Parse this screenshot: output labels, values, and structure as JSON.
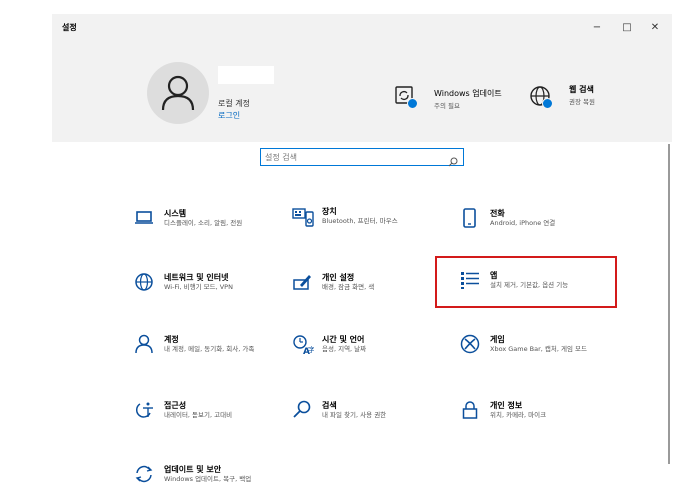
{
  "window": {
    "title": "설정",
    "minimize": "−",
    "maximize": "□",
    "close": "✕"
  },
  "header": {
    "account": {
      "label": "로컬 계정",
      "signin_link": "로그인"
    },
    "windows_update": {
      "title": "Windows 업데이트",
      "subtitle": "주의 필요",
      "icon": "windows-update-icon"
    },
    "web_search": {
      "title": "웹 검색",
      "subtitle": "권장 복원",
      "icon": "globe-icon"
    }
  },
  "search": {
    "placeholder": "설정 검색"
  },
  "tiles": [
    {
      "title": "시스템",
      "subtitle": "디스플레이, 소리, 알림, 전원",
      "icon": "laptop-icon"
    },
    {
      "title": "장치",
      "subtitle": "Bluetooth, 프린터, 마우스",
      "icon": "keyboard-speaker-icon"
    },
    {
      "title": "전화",
      "subtitle": "Android, iPhone 연결",
      "icon": "phone-icon"
    },
    {
      "title": "네트워크 및 인터넷",
      "subtitle": "Wi-Fi, 비행기 모드, VPN",
      "icon": "globe-icon"
    },
    {
      "title": "개인 설정",
      "subtitle": "배경, 잠금 화면, 색",
      "icon": "paint-icon"
    },
    {
      "title": "앱",
      "subtitle": "설치 제거, 기본값, 옵션 기능",
      "icon": "apps-list-icon"
    },
    {
      "title": "계정",
      "subtitle": "내 계정, 메일, 동기화, 회사, 가족",
      "icon": "person-icon"
    },
    {
      "title": "시간 및 언어",
      "subtitle": "음성, 지역, 날짜",
      "icon": "time-language-icon"
    },
    {
      "title": "게임",
      "subtitle": "Xbox Game Bar, 캡처, 게임 모드",
      "icon": "xbox-icon"
    },
    {
      "title": "접근성",
      "subtitle": "내레이터, 돋보기, 고대비",
      "icon": "accessibility-icon"
    },
    {
      "title": "검색",
      "subtitle": "내 파일 찾기, 사용 권한",
      "icon": "search-icon"
    },
    {
      "title": "개인 정보",
      "subtitle": "위치, 카메라, 마이크",
      "icon": "lock-icon"
    },
    {
      "title": "업데이트 및 보안",
      "subtitle": "Windows 업데이트, 복구, 백업",
      "icon": "sync-icon"
    }
  ],
  "colors": {
    "accent": "#0078d7",
    "highlight": "#d31a1a",
    "header_bg": "#f2f2f2"
  }
}
